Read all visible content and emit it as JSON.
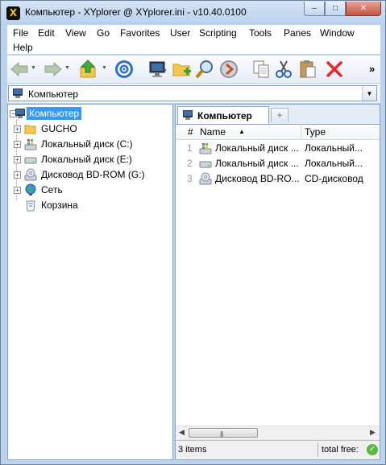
{
  "window": {
    "title": "Компьютер - XYplorer @ XYplorer.ini - v10.40.0100",
    "app_icon_glyph": "X",
    "controls": {
      "minimize": "–",
      "maximize": "□",
      "close": "✕"
    }
  },
  "menu": {
    "items": [
      "File",
      "Edit",
      "View",
      "Go",
      "Favorites",
      "User",
      "Scripting",
      "Tools",
      "Panes",
      "Window",
      "Help"
    ]
  },
  "toolbar": {
    "buttons": [
      "back-icon",
      "forward-icon",
      "up-folder-icon",
      "target-icon",
      "computer-icon",
      "new-folder-icon",
      "search-icon",
      "goto-icon",
      "copy-icon",
      "cut-icon",
      "paste-icon",
      "delete-icon"
    ],
    "overflow_label": "»"
  },
  "address": {
    "value": "Компьютер",
    "dropdown_glyph": "▼"
  },
  "tree": {
    "items": [
      {
        "label": "Компьютер",
        "selected": true,
        "icon": "computer-icon"
      },
      {
        "label": "GUCHO",
        "icon": "folder-icon"
      },
      {
        "label": "Локальный диск (C:)",
        "icon": "windows-drive-icon"
      },
      {
        "label": "Локальный диск (E:)",
        "icon": "drive-icon"
      },
      {
        "label": "Дисковод BD-ROM (G:)",
        "icon": "optical-drive-icon"
      },
      {
        "label": "Сеть",
        "icon": "network-icon"
      },
      {
        "label": "Корзина",
        "icon": "recycle-bin-icon"
      }
    ]
  },
  "list": {
    "tab_label": "Компьютер",
    "new_tab_glyph": "+",
    "columns": {
      "num": "#",
      "name": "Name",
      "sort_glyph": "▲",
      "type": "Type"
    },
    "rows": [
      {
        "num": "1",
        "name": "Локальный диск ...",
        "type": "Локальный...",
        "icon": "windows-drive-icon"
      },
      {
        "num": "2",
        "name": "Локальный диск ...",
        "type": "Локальный...",
        "icon": "drive-icon"
      },
      {
        "num": "3",
        "name": "Дисковод BD-RO...",
        "type": "CD-дисковод",
        "icon": "optical-drive-icon"
      }
    ],
    "scroll": {
      "left": "◀",
      "right": "▶",
      "grip": "|||"
    }
  },
  "status": {
    "count": "3 items",
    "free": "total free:",
    "ok_glyph": "✓"
  },
  "colors": {
    "selection": "#3399ff",
    "chrome": "#bcd3ee",
    "delete": "#e8262c"
  }
}
